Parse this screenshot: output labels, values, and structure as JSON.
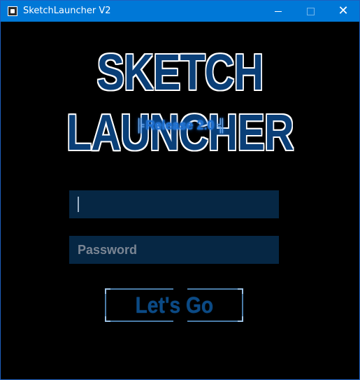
{
  "window": {
    "title": "SketchLauncher V2",
    "controls": {
      "minimize": "minimize-icon",
      "maximize": "maximize-icon",
      "close_glyph": "✕"
    },
    "titlebar_color": "#0078d7"
  },
  "logo": {
    "title": "SKETCH LAUNCHER",
    "release_bar_left": "╠",
    "release_text": "Release 2.0",
    "release_bar_right": "╣"
  },
  "form": {
    "username": {
      "value": "",
      "placeholder": ""
    },
    "password": {
      "value": "",
      "placeholder": "Password"
    },
    "submit_label": "Let's Go"
  },
  "colors": {
    "background": "#000000",
    "field_bg": "#062744",
    "accent": "#0b4a85"
  }
}
